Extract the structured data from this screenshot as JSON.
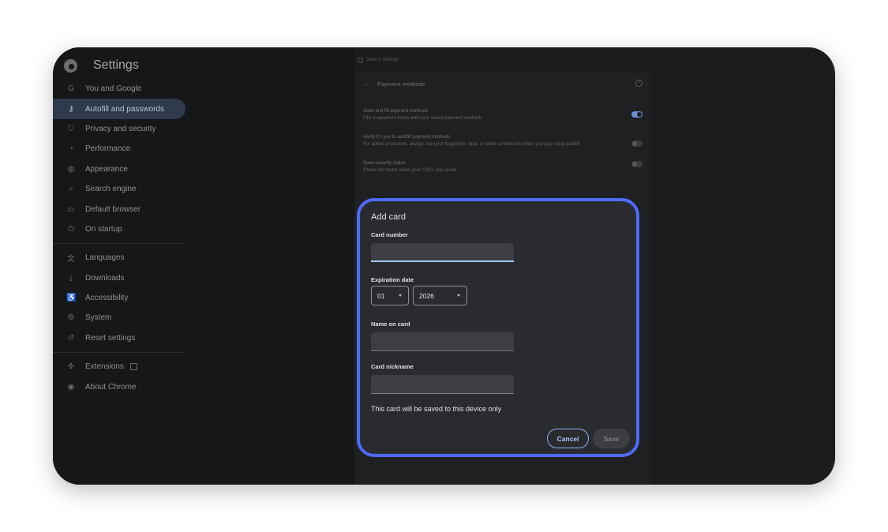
{
  "app": {
    "title": "Settings"
  },
  "search": {
    "placeholder": "Search settings"
  },
  "sidebar": {
    "items": [
      {
        "label": "You and Google",
        "icon": "google-g-icon",
        "glyph": "G"
      },
      {
        "label": "Autofill and passwords",
        "icon": "key-icon",
        "glyph": "⚷",
        "active": true
      },
      {
        "label": "Privacy and security",
        "icon": "shield-icon",
        "glyph": "⛉"
      },
      {
        "label": "Performance",
        "icon": "speedometer-icon",
        "glyph": "◔"
      },
      {
        "label": "Appearance",
        "icon": "palette-icon",
        "glyph": "◍"
      },
      {
        "label": "Search engine",
        "icon": "search-icon",
        "glyph": "⌕"
      },
      {
        "label": "Default browser",
        "icon": "browser-icon",
        "glyph": "▭"
      },
      {
        "label": "On startup",
        "icon": "power-icon",
        "glyph": "⏻"
      },
      {
        "label": "Languages",
        "icon": "translate-icon",
        "glyph": "文"
      },
      {
        "label": "Downloads",
        "icon": "download-icon",
        "glyph": "⤓"
      },
      {
        "label": "Accessibility",
        "icon": "accessibility-icon",
        "glyph": "♿"
      },
      {
        "label": "System",
        "icon": "wrench-icon",
        "glyph": "⚙"
      },
      {
        "label": "Reset settings",
        "icon": "reset-icon",
        "glyph": "↺"
      },
      {
        "label": "Extensions",
        "icon": "puzzle-icon",
        "glyph": "✣"
      },
      {
        "label": "About Chrome",
        "icon": "chrome-icon",
        "glyph": "◉"
      }
    ]
  },
  "panel": {
    "title": "Payment methods",
    "settings": [
      {
        "title": "Save and fill payment methods",
        "desc": "Fills in payment forms with your saved payment methods",
        "on": true
      },
      {
        "title": "Verify it's you to autofill payment methods",
        "desc": "For added protection, always use your fingerprint, face, or other screen lock when you pay using autofill",
        "on": false
      },
      {
        "title": "Save security codes",
        "desc": "Check out faster when your CVCs are saved",
        "on": false
      }
    ]
  },
  "dialog": {
    "title": "Add card",
    "card_number_label": "Card number",
    "card_number_value": "",
    "expiration_label": "Expiration date",
    "month": "01",
    "year": "2026",
    "name_label": "Name on card",
    "name_value": "",
    "nickname_label": "Card nickname",
    "nickname_value": "",
    "note": "This card will be saved to this device only",
    "cancel_label": "Cancel",
    "save_label": "Save"
  },
  "colors": {
    "accent_outline": "#4d6bff",
    "active_nav": "#2f3a4d",
    "toggle_on": "#6f8fd8"
  }
}
